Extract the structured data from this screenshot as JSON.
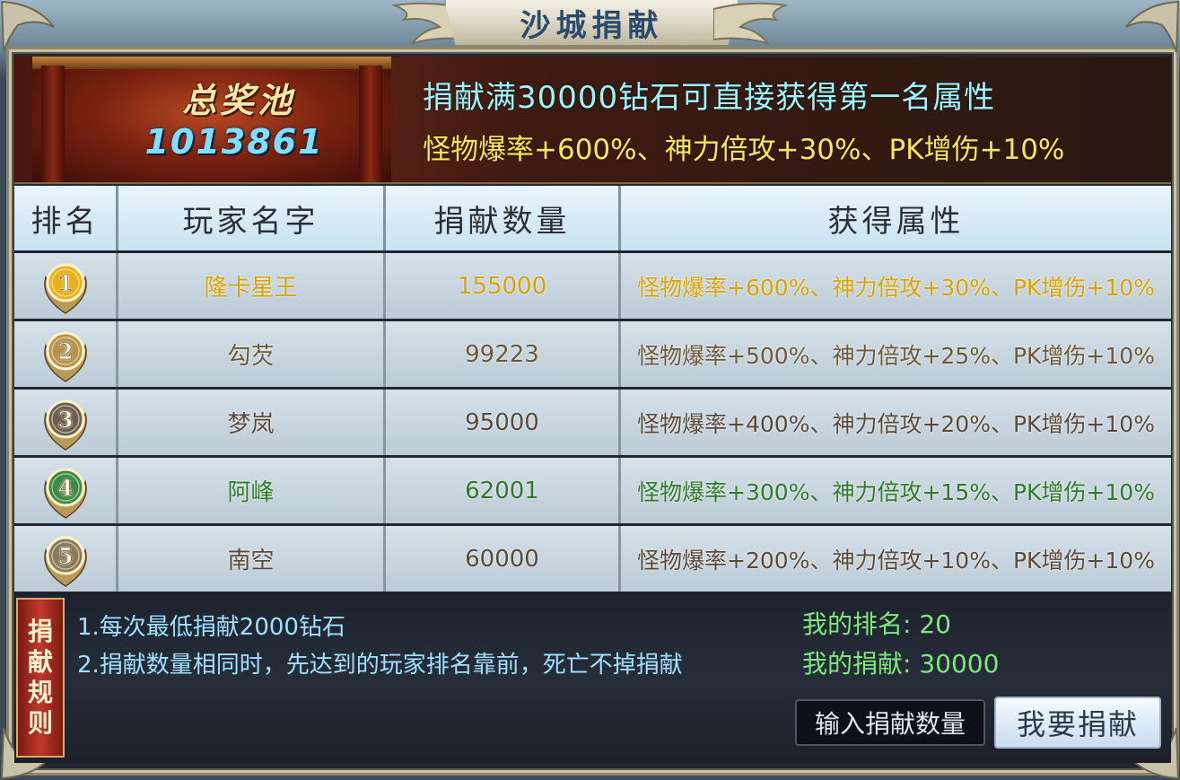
{
  "title": "沙城捐献",
  "prize_pool": {
    "label": "总奖池",
    "value": "1013861"
  },
  "promo": {
    "line1": "捐献满30000钻石可直接获得第一名属性",
    "line2": "怪物爆率+600%、神力倍攻+30%、PK增伤+10%"
  },
  "table": {
    "headers": [
      "排名",
      "玩家名字",
      "捐献数量",
      "获得属性"
    ],
    "rows": [
      {
        "rank": "1",
        "name": "隆卡星王",
        "amount": "155000",
        "attr": "怪物爆率+600%、神力倍攻+30%、PK增伤+10%",
        "color": "#d9a400"
      },
      {
        "rank": "2",
        "name": "勾芡",
        "amount": "99223",
        "attr": "怪物爆率+500%、神力倍攻+25%、PK增伤+10%",
        "color": "#6a5a3a"
      },
      {
        "rank": "3",
        "name": "梦岚",
        "amount": "95000",
        "attr": "怪物爆率+400%、神力倍攻+20%、PK增伤+10%",
        "color": "#5a4a3a"
      },
      {
        "rank": "4",
        "name": "阿峰",
        "amount": "62001",
        "attr": "怪物爆率+300%、神力倍攻+15%、PK增伤+10%",
        "color": "#2f7a2a"
      },
      {
        "rank": "5",
        "name": "南空",
        "amount": "60000",
        "attr": "怪物爆率+200%、神力倍攻+10%、PK增伤+10%",
        "color": "#5a4a3a"
      }
    ],
    "medal_colors": [
      "#e8b21c",
      "#b8914a",
      "#6e5e52",
      "#3e8a44",
      "#8a7a5a"
    ]
  },
  "rules": {
    "tag": [
      "捐",
      "献",
      "规",
      "则"
    ],
    "line1": "1.每次最低捐献2000钻石",
    "line2": "2.捐献数量相同时，先达到的玩家排名靠前，死亡不掉捐献"
  },
  "my": {
    "rank_label": "我的排名:",
    "rank_value": "20",
    "donate_label": "我的捐献:",
    "donate_value": "30000"
  },
  "input": {
    "placeholder": "输入捐献数量"
  },
  "donate_button": "我要捐献"
}
